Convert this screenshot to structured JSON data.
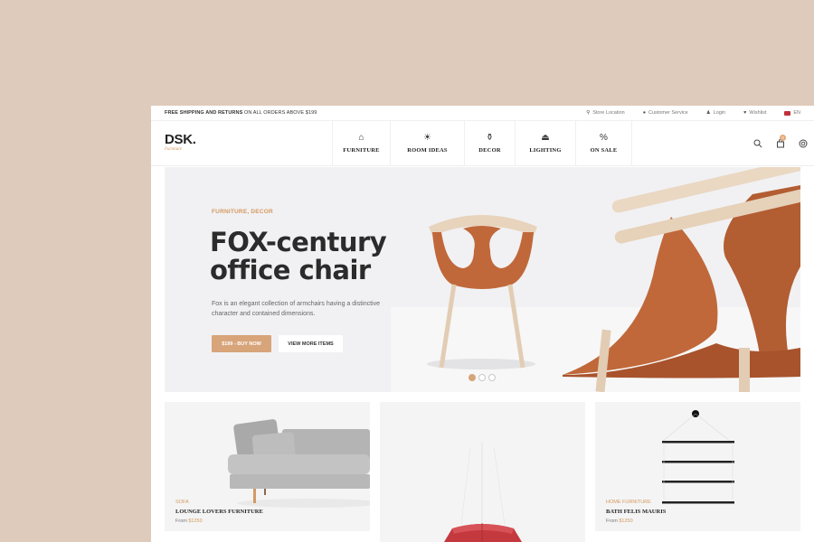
{
  "topbar": {
    "promo_bold": "FREE SHIPPING AND RETURNS",
    "promo_rest": " ON ALL ORDERS ABOVE $199",
    "links": [
      {
        "icon": "map-pin-icon",
        "glyph": "⚲",
        "label": "Store Location"
      },
      {
        "icon": "support-icon",
        "glyph": "●",
        "label": "Customer Service"
      },
      {
        "icon": "user-icon",
        "glyph": "♟",
        "label": "Login"
      },
      {
        "icon": "heart-icon",
        "glyph": "♥",
        "label": "Wishlist"
      },
      {
        "icon": "flag-icon",
        "glyph": "",
        "label": "EN"
      }
    ]
  },
  "header": {
    "logo": "DSK.",
    "logo_sub": "Furniture",
    "nav": [
      {
        "icon": "armchair-icon",
        "glyph": "⌂",
        "label": "FURNITURE"
      },
      {
        "icon": "lightbulb-icon",
        "glyph": "☀",
        "label": "ROOM IDEAS"
      },
      {
        "icon": "vase-icon",
        "glyph": "⚱",
        "label": "DECOR"
      },
      {
        "icon": "lamp-icon",
        "glyph": "⏏",
        "label": "LIGHTING"
      },
      {
        "icon": "discount-icon",
        "glyph": "%",
        "label": "ON SALE"
      }
    ],
    "icons": {
      "search": "⌕",
      "cart": "⛶",
      "cart_count": "0",
      "account": "◎"
    }
  },
  "hero": {
    "category": "FURNITURE, DECOR",
    "title_line1": "FOX-century",
    "title_line2": "office chair",
    "description": "Fox is an elegant collection of armchairs having a distinctive character and contained dimensions.",
    "buy_label": "$199 - BUY NOW",
    "more_label": "VIEW MORE ITEMS",
    "slides": 3,
    "active_slide": 1,
    "colors": {
      "accent": "#d8a47a",
      "leather": "#c0683a",
      "wood": "#e8d3bc"
    }
  },
  "cards": [
    {
      "category": "SOFA",
      "name": "LOUNGE LOVERS FURNITURE",
      "price_prefix": "From ",
      "price": "$1250"
    },
    {
      "category": "",
      "name": "",
      "price_prefix": "",
      "price": ""
    },
    {
      "category": "HOME FURNITURE",
      "name": "BATH FELIS MAURIS",
      "price_prefix": "From ",
      "price": "$1250"
    }
  ]
}
